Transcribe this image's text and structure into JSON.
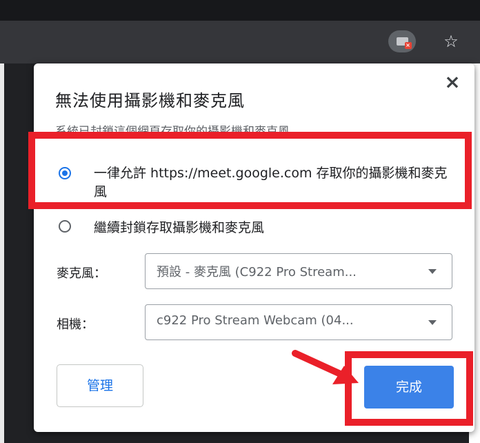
{
  "browser": {
    "camera_icon": "camera-blocked-icon",
    "star_icon": "star-icon",
    "star_glyph": "☆",
    "edge_glyph": "I"
  },
  "dialog": {
    "close_glyph": "×",
    "title": "無法使用攝影機和麥克風",
    "subtitle": "系統已封鎖這個網頁存取你的攝影機和麥克風",
    "option_allow": "一律允許 https://meet.google.com 存取你的攝影機和麥克風",
    "option_block": "繼續封鎖存取攝影機和麥克風",
    "selected_option": "allow",
    "microphone_label": "麥克風：",
    "microphone_value": "預設 - 麥克風 (C922 Pro Stream...",
    "camera_label": "相機：",
    "camera_value": "c922 Pro Stream Webcam (04...",
    "manage_button": "管理",
    "done_button": "完成"
  },
  "colors": {
    "accent": "#1a73e8",
    "highlight": "#ea2029",
    "done_bg": "#3b82e8"
  }
}
